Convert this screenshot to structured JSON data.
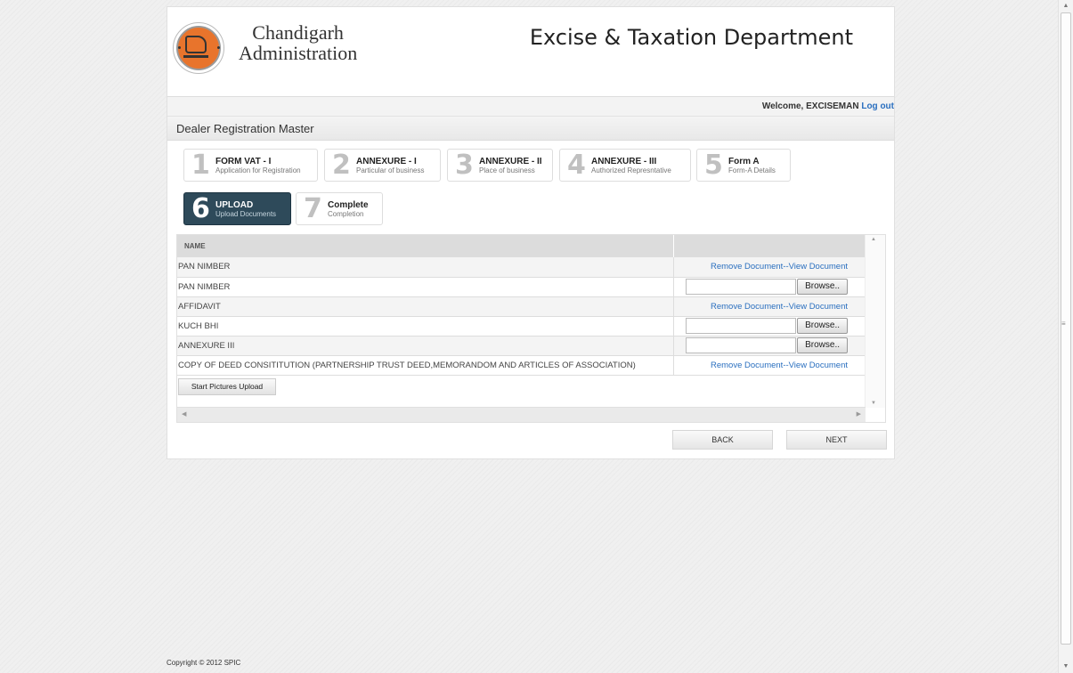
{
  "header": {
    "org_line1": "Chandigarh",
    "org_line2": "Administration",
    "department": "Excise & Taxation Department"
  },
  "welcome": {
    "text": "Welcome, EXCISEMAN",
    "logout": "Log out"
  },
  "section_title": "Dealer Registration Master",
  "steps": [
    {
      "num": "1",
      "title": "FORM VAT - I",
      "sub": "Application for Registration",
      "active": false
    },
    {
      "num": "2",
      "title": "ANNEXURE - I",
      "sub": "Particular of business",
      "active": false
    },
    {
      "num": "3",
      "title": "ANNEXURE - II",
      "sub": "Place of business",
      "active": false
    },
    {
      "num": "4",
      "title": "ANNEXURE - III",
      "sub": "Authorized Represntative",
      "active": false
    },
    {
      "num": "5",
      "title": "Form A",
      "sub": "Form-A Details",
      "active": false
    },
    {
      "num": "6",
      "title": "UPLOAD",
      "sub": "Upload Documents",
      "active": true
    },
    {
      "num": "7",
      "title": "Complete",
      "sub": "Completion",
      "active": false
    }
  ],
  "table": {
    "header": "NAME",
    "remove_label": "Remove Document",
    "separator": "--",
    "view_label": "View Document",
    "browse_label": "Browse..",
    "rows": [
      {
        "name": "PAN NIMBER",
        "action": "links"
      },
      {
        "name": "PAN NIMBER",
        "action": "browse"
      },
      {
        "name": "AFFIDAVIT",
        "action": "links"
      },
      {
        "name": "KUCH BHI",
        "action": "browse"
      },
      {
        "name": "ANNEXURE III",
        "action": "browse"
      },
      {
        "name": "COPY OF DEED CONSITITUTION (PARTNERSHIP TRUST DEED,MEMORANDOM AND ARTICLES OF ASSOCIATION)",
        "action": "links"
      }
    ]
  },
  "upload_button": "Start Pictures Upload",
  "nav": {
    "back": "BACK",
    "next": "NEXT"
  },
  "footer": "Copyright © 2012 SPIC"
}
